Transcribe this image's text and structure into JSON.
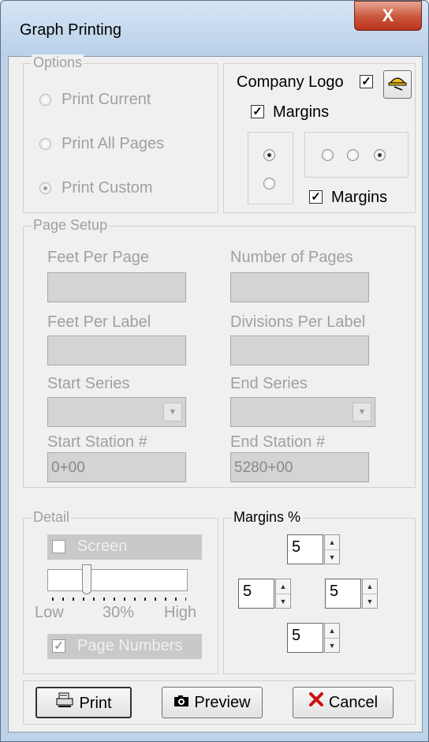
{
  "window": {
    "title": "Graph Printing",
    "close_label": "X"
  },
  "options": {
    "legend": "Options",
    "print_current": "Print Current",
    "print_all_pages": "Print All Pages",
    "print_custom": "Print Custom",
    "selected": "Print Custom"
  },
  "logo_group": {
    "company_logo_label": "Company Logo",
    "company_logo_checked": true,
    "margins_label": "Margins",
    "margins_checked": true,
    "vertical_selected": 1,
    "horizontal_selected": 3,
    "margins2_label": "Margins",
    "margins2_checked": true,
    "logo_icon": "hardhat-icon"
  },
  "page_setup": {
    "legend": "Page Setup",
    "feet_per_page_label": "Feet Per Page",
    "number_of_pages_label": "Number of Pages",
    "feet_per_label_label": "Feet Per Label",
    "divisions_per_label_label": "Divisions Per Label",
    "start_series_label": "Start Series",
    "end_series_label": "End Series",
    "start_station_label": "Start Station #",
    "start_station_value": "0+00",
    "end_station_label": "End Station #",
    "end_station_value": "5280+00"
  },
  "detail": {
    "legend": "Detail",
    "screen_label": "Screen",
    "screen_checked": false,
    "slider_value_pct": 30,
    "low_label": "Low",
    "pct_label": "30%",
    "high_label": "High",
    "page_numbers_label": "Page Numbers",
    "page_numbers_checked": true
  },
  "margins": {
    "legend": "Margins %",
    "top": "5",
    "left": "5",
    "right": "5",
    "bottom": "5"
  },
  "buttons": {
    "print": "Print",
    "preview": "Preview",
    "cancel": "Cancel"
  },
  "colors": {
    "cancel_x": "#cc1111",
    "titlebar": "#bcd3ea",
    "close": "#c9543a"
  }
}
